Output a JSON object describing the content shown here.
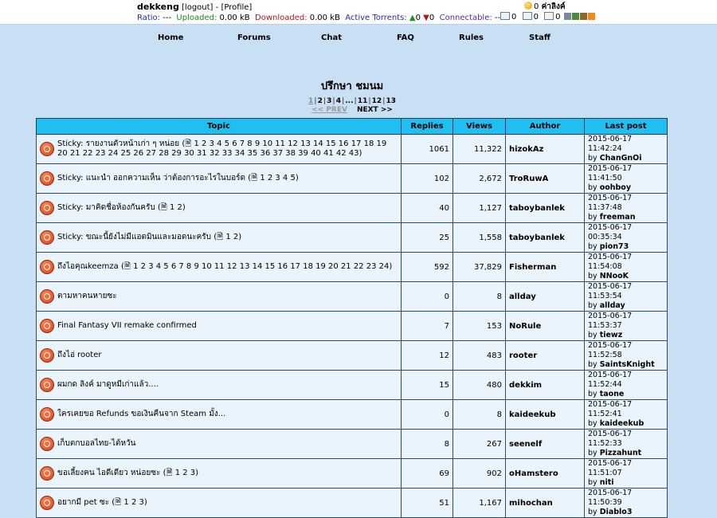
{
  "user": {
    "username": "dekkeng",
    "logout": "[logout]",
    "dash": " - ",
    "profile": "[Profile]"
  },
  "stats": {
    "ratio_label": "Ratio:",
    "ratio_value": "---",
    "uploaded_label": "Uploaded:",
    "uploaded_value": "0.00 kB",
    "downloaded_label": "Downloaded:",
    "downloaded_value": "0.00 kB",
    "active_label": "Active Torrents:",
    "seeding": "0",
    "leeching": "0",
    "connectable_label": "Connectable:",
    "connectable_value": "---"
  },
  "topright": {
    "points": "0",
    "points_label": "ค่าลิงค์",
    "inbox": "0",
    "sentbox": "0",
    "other": "0"
  },
  "nav": [
    "Home",
    "Forums",
    "Chat",
    "FAQ",
    "Rules",
    "Staff"
  ],
  "page_title": "ปรึกษา ชมนม",
  "pager": {
    "pages": [
      "1",
      "2",
      "3",
      "4",
      "...",
      "11",
      "12",
      "13"
    ],
    "prev": "<< PREV",
    "next": "NEXT >>"
  },
  "columns": [
    "Topic",
    "Replies",
    "Views",
    "Author",
    "Last post"
  ],
  "topics": [
    {
      "title": "Sticky: รายงานตัวหน้าเก่า ๆ หน่อย",
      "pages": "1 2 3 4 5 6 7 8 9 10 11 12 13 14 15 16 17 18 19 20 21 22 23 24 25 26 27 28 29 30 31 32 33 34 35 36 37 38 39 40 41 42 43",
      "replies": "1061",
      "views": "11,322",
      "author": "hizokAz",
      "date": "2015-06-17 11:42:24",
      "by": "by",
      "last_user": "ChanGnOi"
    },
    {
      "title": "Sticky: แนะนำ ออกความเห็น ว่าต้องการอะไรในบอร์ด",
      "pages": "1 2 3 4 5",
      "replies": "102",
      "views": "2,672",
      "author": "TroRuwA",
      "date": "2015-06-17 11:41:50",
      "by": "by",
      "last_user": "oohboy"
    },
    {
      "title": "Sticky: มาคิดชื่อห้องกันครับ",
      "pages": "1 2",
      "replies": "40",
      "views": "1,127",
      "author": "taboybanlek",
      "date": "2015-06-17 11:37:48",
      "by": "by",
      "last_user": "freeman"
    },
    {
      "title": "Sticky: ขณะนี้ยังไม่มีแอดมินและมอดนะครับ",
      "pages": "1 2",
      "replies": "25",
      "views": "1,558",
      "author": "taboybanlek",
      "date": "2015-06-17 00:35:34",
      "by": "by",
      "last_user": "pion73"
    },
    {
      "title": "ถึงไอคุณkeemza",
      "pages": "1 2 3 4 5 6 7 8 9 10 11 12 13 14 15 16 17 18 19 20 21 22 23 24",
      "replies": "592",
      "views": "37,829",
      "author": "Fisherman",
      "date": "2015-06-17 11:54:08",
      "by": "by",
      "last_user": "NNooK"
    },
    {
      "title": "ตามหาคนหายซะ",
      "pages": "",
      "replies": "0",
      "views": "8",
      "author": "allday",
      "date": "2015-06-17 11:53:54",
      "by": "by",
      "last_user": "allday"
    },
    {
      "title": "Final Fantasy VII remake confirmed",
      "pages": "",
      "replies": "7",
      "views": "153",
      "author": "NoRule",
      "date": "2015-06-17 11:53:37",
      "by": "by",
      "last_user": "tiewz"
    },
    {
      "title": "ถึงไอ่ rooter",
      "pages": "",
      "replies": "12",
      "views": "483",
      "author": "rooter",
      "date": "2015-06-17 11:52:58",
      "by": "by",
      "last_user": "SaintsKnight"
    },
    {
      "title": "ผมกด ลิงค์ มาดูหมีเก่าแล้ว....",
      "pages": "",
      "replies": "15",
      "views": "480",
      "author": "dekkim",
      "date": "2015-06-17 11:52:44",
      "by": "by",
      "last_user": "taone"
    },
    {
      "title": "ใครเคยขอ Refunds ขอเงินคืนจาก Steam มั้ง...",
      "pages": "",
      "replies": "0",
      "views": "8",
      "author": "kaideekub",
      "date": "2015-06-17 11:52:41",
      "by": "by",
      "last_user": "kaideekub"
    },
    {
      "title": "เก็บตกบอลไทย-ไต้หวัน",
      "pages": "",
      "replies": "8",
      "views": "267",
      "author": "seenelf",
      "date": "2015-06-17 11:52:33",
      "by": "by",
      "last_user": "Pizzahunt"
    },
    {
      "title": "ขอเลี้ยงคน ไอดีเดียว หน่อยซะ",
      "pages": "1 2 3",
      "replies": "69",
      "views": "902",
      "author": "oHamstero",
      "date": "2015-06-17 11:51:07",
      "by": "by",
      "last_user": "niti"
    },
    {
      "title": "อยากมี pet ซะ",
      "pages": "1 2 3",
      "replies": "51",
      "views": "1,167",
      "author": "mihochan",
      "date": "2015-06-17 11:50:39",
      "by": "by",
      "last_user": "Diablo3"
    }
  ],
  "colors": {
    "page_bg": "#c9dff3",
    "header_bg": "#1fbff2",
    "row_bg": "#eaf4fc",
    "blue_label": "#1f2fa8",
    "green_label": "#1a8a1a",
    "red_label": "#b01818"
  }
}
